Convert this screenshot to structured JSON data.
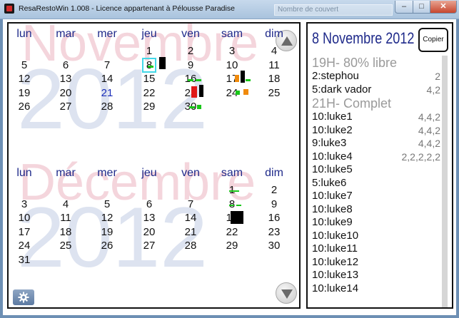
{
  "window": {
    "title": "ResaRestoWin 1.008 - Licence appartenant à Pélousse Paradise",
    "ghost_search": "Nombre de couvert",
    "minimize": "–",
    "maximize": "□",
    "close": "✕"
  },
  "calendar": {
    "weekdays": [
      "lun",
      "mar",
      "mer",
      "jeu",
      "ven",
      "sam",
      "dim"
    ],
    "months": [
      {
        "watermark_month": "Novembre",
        "watermark_year": "2012",
        "weeks": [
          [
            "",
            "",
            "",
            "1",
            "2",
            "3",
            "4"
          ],
          [
            "5",
            "6",
            "7",
            "8",
            "9",
            "10",
            "11"
          ],
          [
            "12",
            "13",
            "14",
            "15",
            "16",
            "17",
            "18"
          ],
          [
            "19",
            "20",
            "21",
            "22",
            "23",
            "24",
            "25"
          ],
          [
            "26",
            "27",
            "28",
            "29",
            "30",
            "",
            ""
          ]
        ]
      },
      {
        "watermark_month": "Décembre",
        "watermark_year": "2012",
        "weeks": [
          [
            "",
            "",
            "",
            "",
            "",
            "1",
            "2"
          ],
          [
            "3",
            "4",
            "5",
            "6",
            "7",
            "8",
            "9"
          ],
          [
            "10",
            "11",
            "12",
            "13",
            "14",
            "15",
            "16"
          ],
          [
            "17",
            "18",
            "19",
            "20",
            "21",
            "22",
            "23"
          ],
          [
            "24",
            "25",
            "26",
            "27",
            "28",
            "29",
            "30"
          ],
          [
            "31",
            "",
            "",
            "",
            "",
            "",
            ""
          ]
        ]
      }
    ],
    "selected_day": "8 Novembre",
    "highlight_day": "21 Novembre",
    "up_icon": "arrow-up-icon",
    "down_icon": "arrow-down-icon",
    "settings_icon": "gear-icon"
  },
  "booking": {
    "date_title": "8 Novembre 2012",
    "copy_label": "Copier",
    "rows": [
      {
        "label": "19H- 80% libre",
        "value": "",
        "header": true
      },
      {
        "label": "2:stephou",
        "value": "2"
      },
      {
        "label": "5:dark vador",
        "value": "4,2"
      },
      {
        "label": "21H- Complet",
        "value": "",
        "header": true
      },
      {
        "label": "10:luke1",
        "value": "4,4,2"
      },
      {
        "label": "10:luke2",
        "value": "4,4,2"
      },
      {
        "label": "9:luke3",
        "value": "4,4,2"
      },
      {
        "label": "10:luke4",
        "value": "2,2,2,2,2"
      },
      {
        "label": "10:luke5",
        "value": ""
      },
      {
        "label": "5:luke6",
        "value": ""
      },
      {
        "label": "10:luke7",
        "value": ""
      },
      {
        "label": "10:luke8",
        "value": ""
      },
      {
        "label": "10:luke9",
        "value": ""
      },
      {
        "label": "10:luke10",
        "value": ""
      },
      {
        "label": "10:luke11",
        "value": ""
      },
      {
        "label": "10:luke12",
        "value": ""
      },
      {
        "label": "10:luke13",
        "value": ""
      },
      {
        "label": "10:luke14",
        "value": ""
      }
    ]
  },
  "colors": {
    "accent_blue": "#1f2a8a",
    "occupancy_green": "#19c719",
    "occupancy_red": "#e01818",
    "occupancy_orange": "#f08a0c",
    "selection_cyan": "#42d8e8"
  }
}
